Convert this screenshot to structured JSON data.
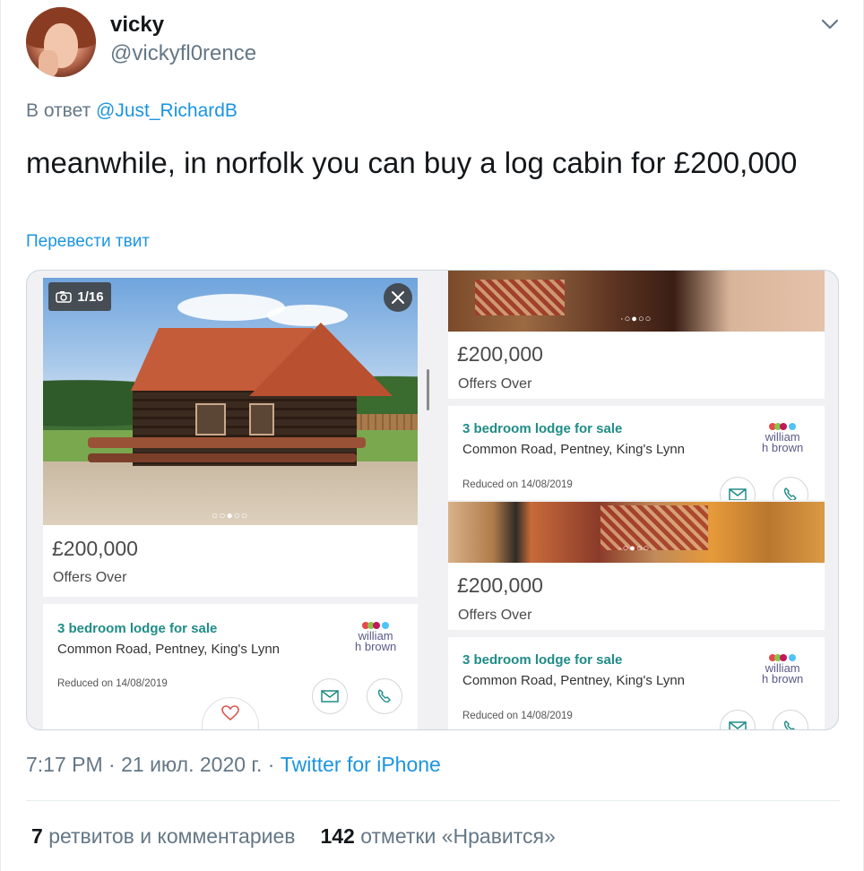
{
  "author": {
    "name": "vicky",
    "handle": "@vickyfl0rence"
  },
  "reply": {
    "prefix": "В ответ",
    "mention": "@Just_RichardB"
  },
  "tweet_text": "meanwhile, in norfolk you can buy a log cabin for £200,000",
  "translate_label": "Перевести твит",
  "media": {
    "listings": [
      {
        "photo_counter": "1/16",
        "price": "£200,000",
        "price_qualifier": "Offers Over",
        "title": "3 bedroom lodge for sale",
        "address": "Common Road, Pentney, King's Lynn",
        "reduced": "Reduced on 14/08/2019",
        "agent": "william h brown",
        "agent_line1": "william",
        "agent_line2": "h brown"
      },
      {
        "price": "£200,000",
        "price_qualifier": "Offers Over",
        "title": "3 bedroom lodge for sale",
        "address": "Common Road, Pentney, King's Lynn",
        "reduced": "Reduced on 14/08/2019",
        "agent_line1": "william",
        "agent_line2": "h brown"
      },
      {
        "price": "£200,000",
        "price_qualifier": "Offers Over",
        "title": "3 bedroom lodge for sale",
        "address": "Common Road, Pentney, King's Lynn",
        "reduced": "Reduced on 14/08/2019",
        "agent_line1": "william",
        "agent_line2": "h brown"
      }
    ],
    "brand_colors": [
      "#e8484a",
      "#8bc34a",
      "#c2185b",
      "#4fc3f7"
    ],
    "accent_color": "#1f8c86"
  },
  "meta": {
    "time": "7:17 PM",
    "separator": "·",
    "date": "21 июл. 2020 г.",
    "source": "Twitter for iPhone"
  },
  "stats": {
    "retweets_count": "7",
    "retweets_label": "ретвитов и комментариев",
    "likes_count": "142",
    "likes_label": "отметки «Нравится»"
  },
  "colors": {
    "link": "#1b95e0",
    "muted": "#657786",
    "text": "#14171a"
  }
}
